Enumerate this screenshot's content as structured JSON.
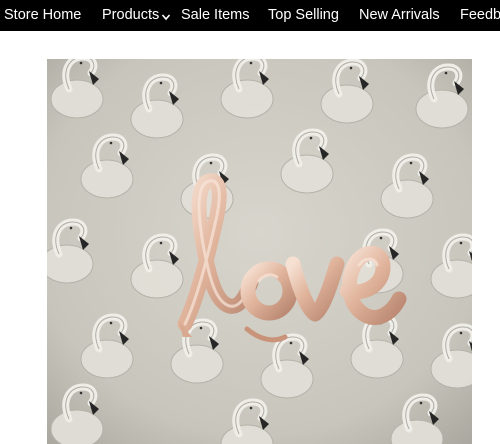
{
  "nav": {
    "items": [
      {
        "label": "Store Home"
      },
      {
        "label": "Products",
        "has_dropdown": true
      },
      {
        "label": "Sale Items"
      },
      {
        "label": "Top Selling"
      },
      {
        "label": "New Arrivals"
      },
      {
        "label": "Feedback"
      }
    ]
  },
  "product_image": {
    "text": "love",
    "colors": {
      "wallpaper": "#cfccc4",
      "flamingo_beak": "#1e1e1e",
      "balloon": "#e3b8a2",
      "balloon_highlight": "#f7e3d8"
    }
  },
  "colors": {
    "nav_background": "#000000",
    "nav_text": "#ffffff",
    "page_background": "#ffffff"
  }
}
